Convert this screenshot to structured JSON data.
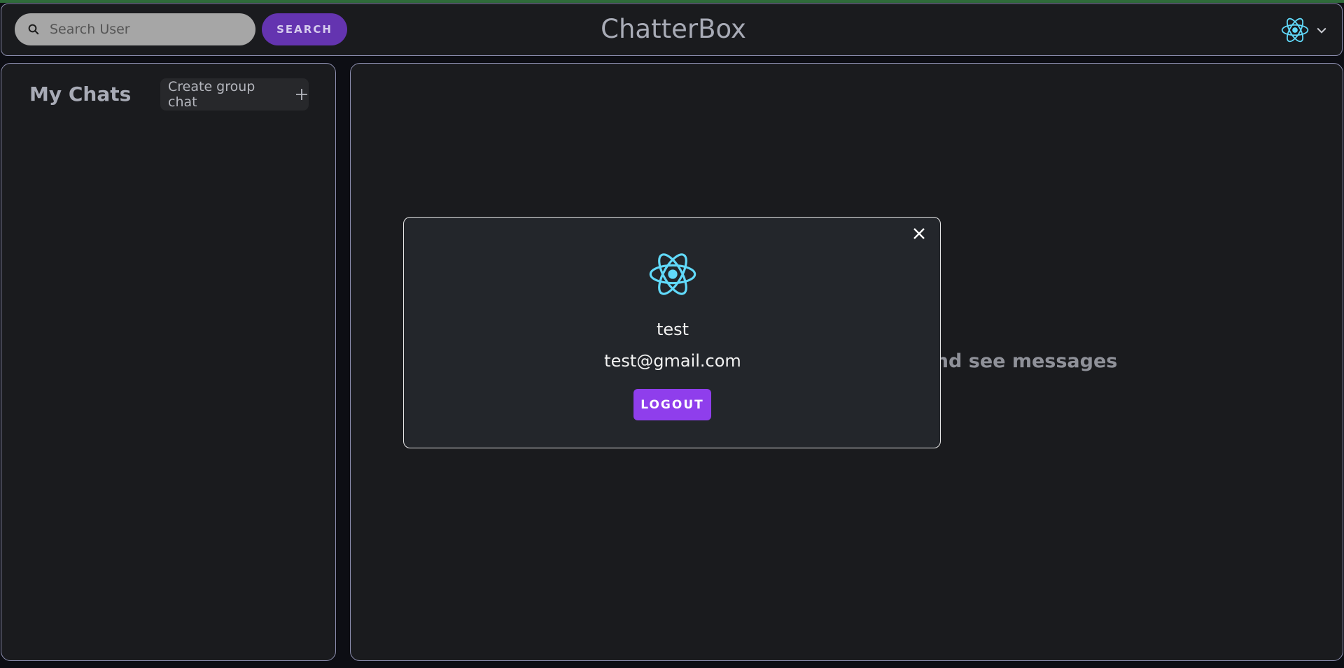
{
  "header": {
    "search_placeholder": "Search User",
    "search_button": "SEARCH",
    "app_title": "ChatterBox",
    "profile_icon": "react-logo-icon",
    "chevron_icon": "chevron-down-icon"
  },
  "sidebar": {
    "title": "My Chats",
    "create_group_label": "Create group chat",
    "create_group_icon": "plus-icon"
  },
  "main": {
    "empty_message": "Click on a user to start chatting and see messages"
  },
  "profile_modal": {
    "name": "test",
    "email": "test@gmail.com",
    "logout_label": "LOGOUT",
    "close_icon": "close-icon",
    "avatar_icon": "react-logo-icon"
  },
  "colors": {
    "accent_purple": "#8f3eec",
    "search_button_bg": "#6434b0",
    "react_cyan": "#61dafb",
    "panel_bg": "#1a1b1e",
    "modal_bg": "#23262b"
  }
}
